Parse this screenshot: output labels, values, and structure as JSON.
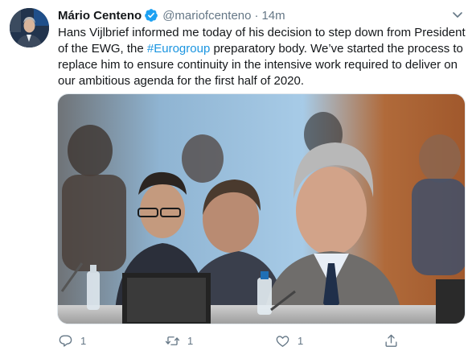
{
  "tweet": {
    "display_name": "Mário Centeno",
    "handle": "@mariofcenteno",
    "separator": "·",
    "time": "14m",
    "text_part1": "Hans Vijlbrief informed me today of his decision to step down from President of the EWG, the ",
    "hashtag": "#Eurogroup",
    "text_part2": " preparatory body. We’ve started the process to replace him to ensure continuity in the intensive work required to deliver on our ambitious agenda for the first half of 2020."
  },
  "actions": {
    "reply_count": "1",
    "retweet_count": "1",
    "like_count": "1"
  },
  "colors": {
    "accent": "#1b95e0",
    "muted": "#657786",
    "verified": "#1da1f2"
  },
  "icons": [
    "verified-badge-icon",
    "chevron-down-icon",
    "reply-icon",
    "retweet-icon",
    "like-icon",
    "share-icon"
  ]
}
